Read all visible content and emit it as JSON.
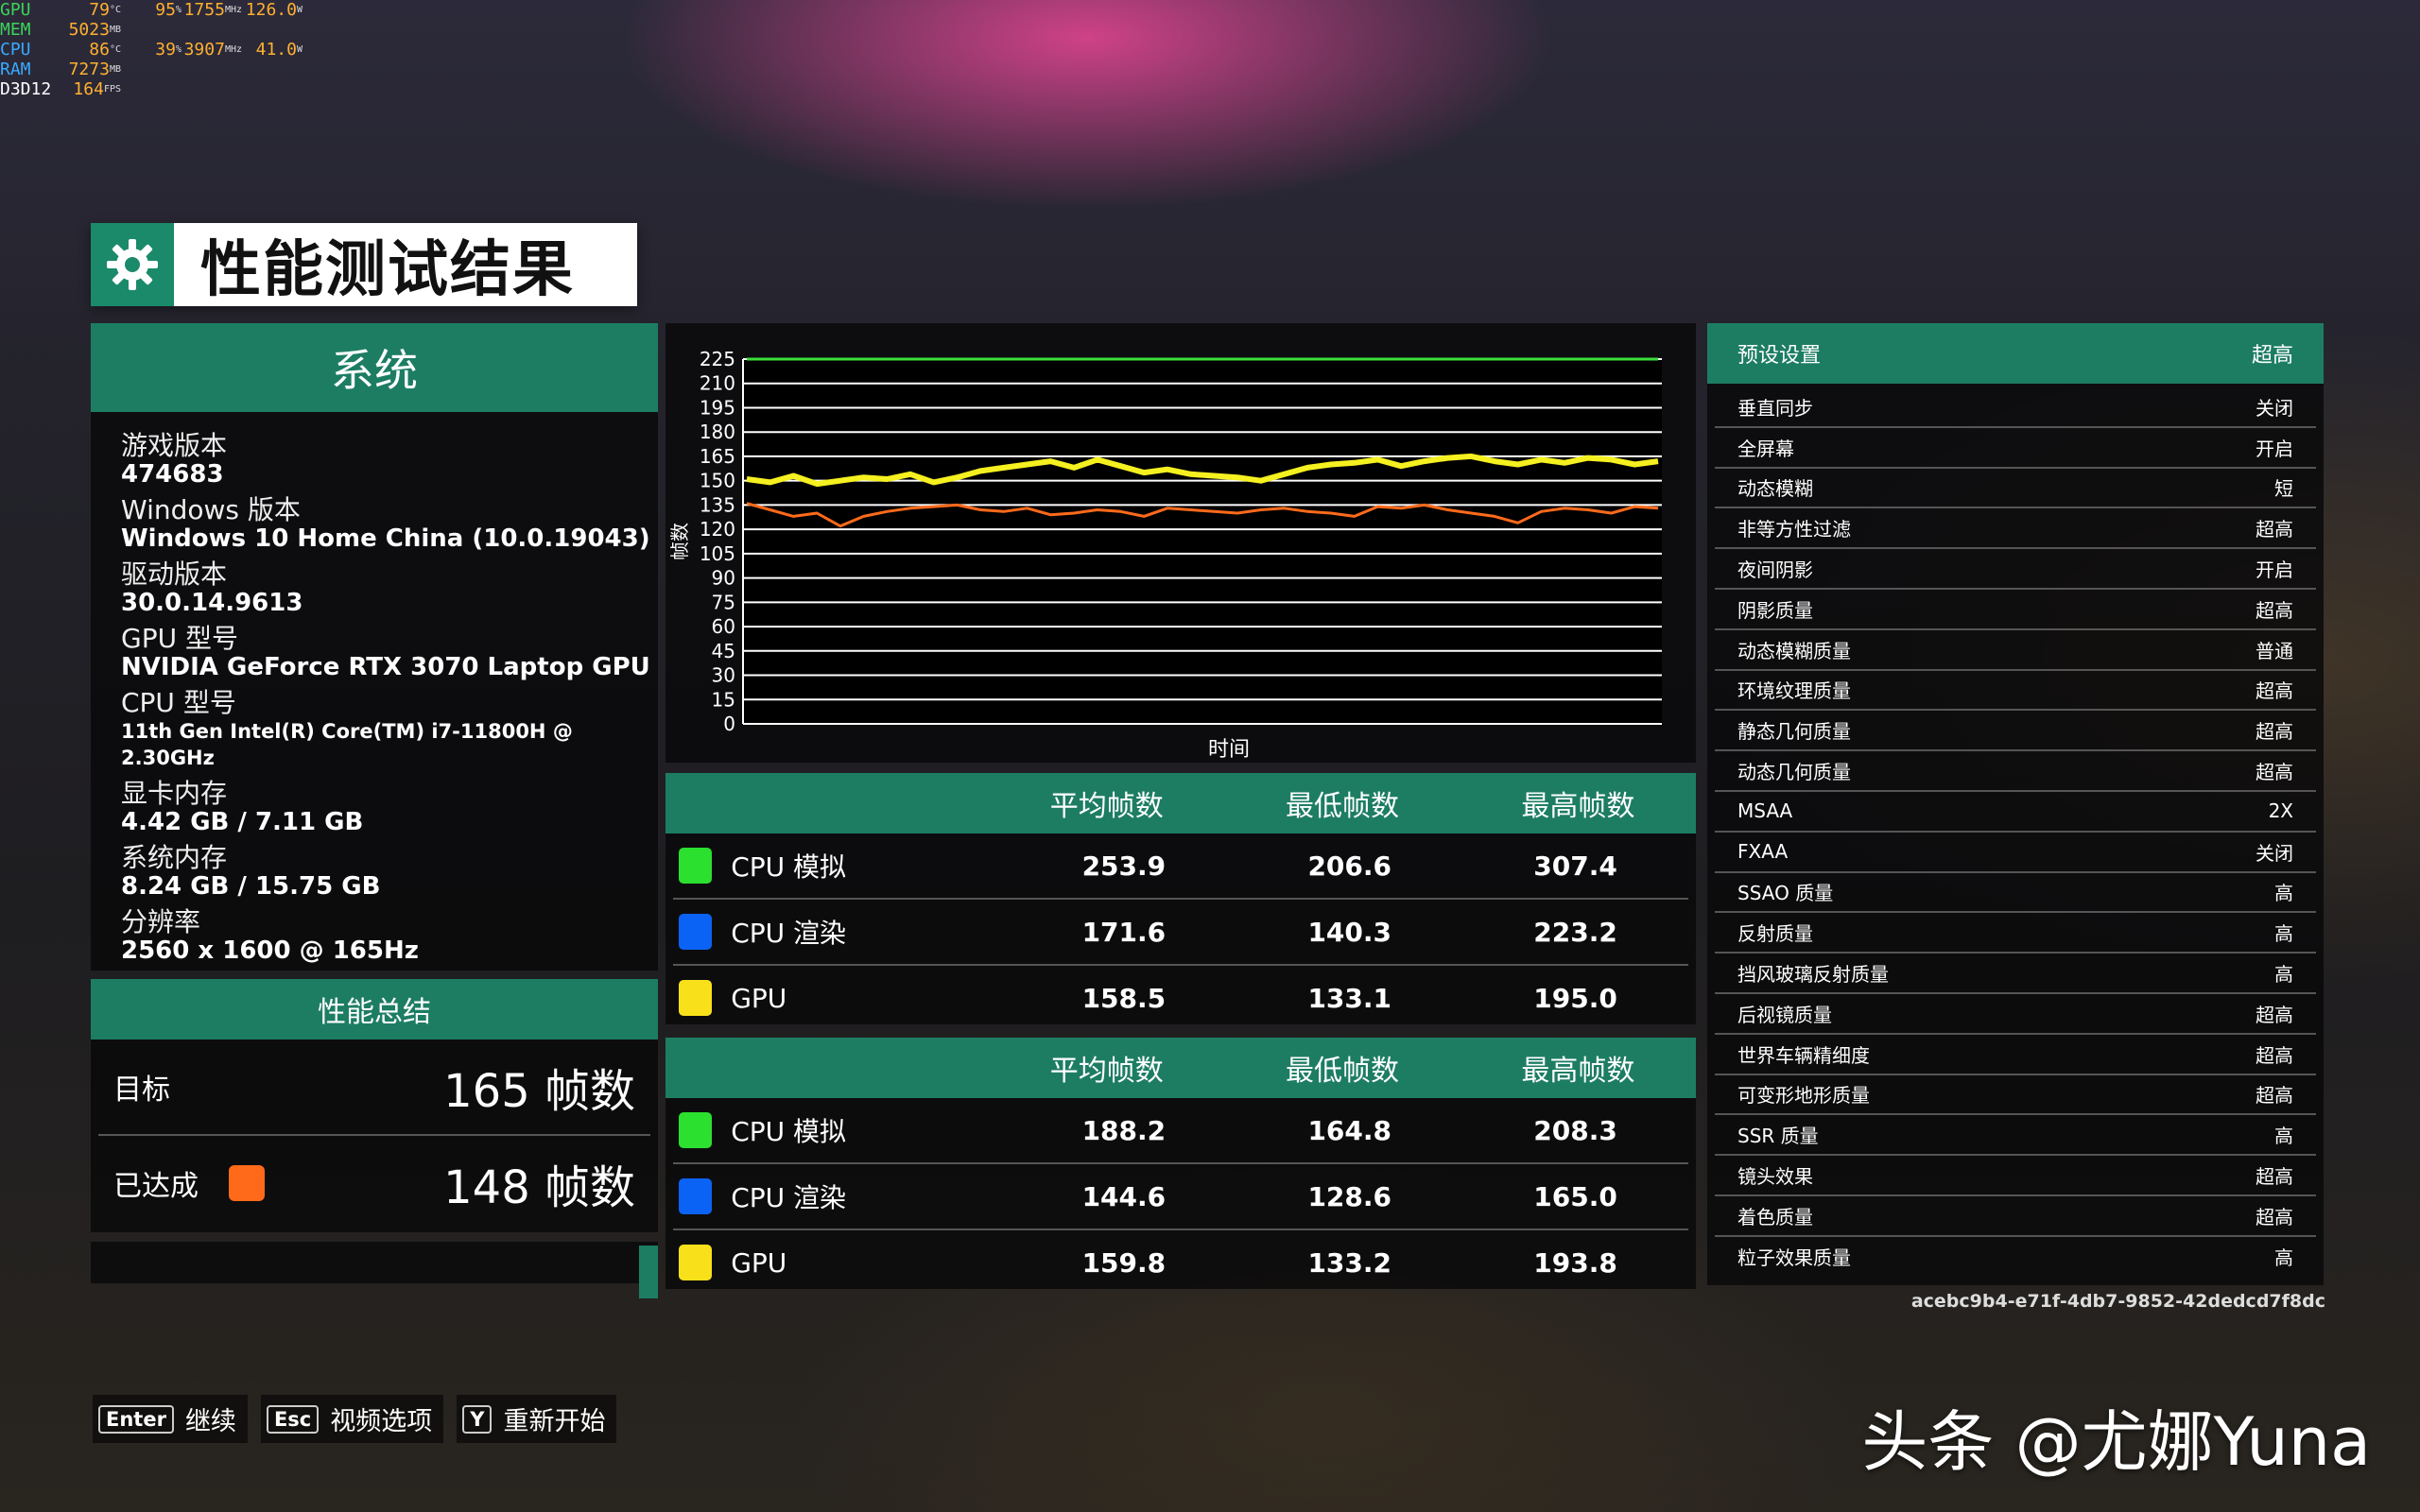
{
  "osd": [
    {
      "label": "GPU",
      "c": "#3cd35a",
      "v1": "79",
      "u1": "°C",
      "v2": "95",
      "u2": "%",
      "v3": "1755",
      "u3": "MHz",
      "v4": "126.0",
      "u4": "W"
    },
    {
      "label": "MEM",
      "c": "#3cd35a",
      "v1": "5023",
      "u1": "MB",
      "v2": "",
      "u2": "",
      "v3": "",
      "u3": "",
      "v4": "",
      "u4": ""
    },
    {
      "label": "CPU",
      "c": "#3aa9ff",
      "v1": "86",
      "u1": "°C",
      "v2": "39",
      "u2": "%",
      "v3": "3907",
      "u3": "MHz",
      "v4": "41.0",
      "u4": "W"
    },
    {
      "label": "RAM",
      "c": "#3aa9ff",
      "v1": "7273",
      "u1": "MB",
      "v2": "",
      "u2": "",
      "v3": "",
      "u3": "",
      "v4": "",
      "u4": ""
    },
    {
      "label": "D3D12",
      "c": "#ffffff",
      "v1": "164",
      "u1": "FPS",
      "v2": "",
      "u2": "",
      "v3": "",
      "u3": "",
      "v4": "",
      "u4": ""
    }
  ],
  "title": "性能测试结果",
  "system": {
    "header": "系统",
    "fields": [
      {
        "label": "游戏版本",
        "value": "474683"
      },
      {
        "label": "Windows 版本",
        "value": "Windows 10 Home China (10.0.19043)"
      },
      {
        "label": "驱动版本",
        "value": "30.0.14.9613"
      },
      {
        "label": "GPU 型号",
        "value": "NVIDIA GeForce RTX 3070 Laptop GPU"
      },
      {
        "label": "CPU 型号",
        "value": "11th Gen Intel(R) Core(TM) i7-11800H @ 2.30GHz"
      },
      {
        "label": "显卡内存",
        "value": "4.42 GB / 7.11 GB"
      },
      {
        "label": "系统内存",
        "value": "8.24 GB / 15.75 GB"
      },
      {
        "label": "分辨率",
        "value": "2560 x 1600 @ 165Hz"
      }
    ]
  },
  "summary": {
    "header": "性能总结",
    "target_label": "目标",
    "target_value": "165 帧数",
    "achieved_label": "已达成",
    "achieved_value": "148 帧数",
    "achieved_color": "#ff6a1a"
  },
  "chart_data": {
    "type": "line",
    "ylabel": "帧数",
    "xlabel": "时间",
    "ylim": [
      0,
      225
    ],
    "yticks": [
      0,
      15,
      30,
      45,
      60,
      75,
      90,
      105,
      120,
      135,
      150,
      165,
      180,
      195,
      210,
      225
    ],
    "grid": true,
    "series": [
      {
        "color": "#39e03a",
        "values": [
          225,
          225,
          225,
          225,
          225,
          225,
          225,
          225,
          225,
          225,
          225,
          225,
          225,
          225,
          225,
          225,
          225,
          225,
          225,
          225,
          225,
          225,
          225,
          225,
          225,
          225,
          225,
          225,
          225,
          225,
          225,
          225,
          225,
          225,
          225,
          225,
          225,
          225,
          225,
          225
        ]
      },
      {
        "color": "#f5f01f",
        "values": [
          151,
          149,
          153,
          148,
          150,
          152,
          151,
          154,
          149,
          152,
          156,
          158,
          160,
          162,
          158,
          163,
          159,
          155,
          157,
          154,
          153,
          152,
          150,
          154,
          158,
          160,
          161,
          163,
          159,
          162,
          164,
          165,
          162,
          160,
          163,
          161,
          164,
          163,
          160,
          162
        ]
      },
      {
        "color": "#ff6a1a",
        "values": [
          136,
          132,
          128,
          130,
          122,
          128,
          131,
          133,
          134,
          135,
          132,
          131,
          133,
          129,
          130,
          132,
          131,
          128,
          133,
          132,
          131,
          130,
          132,
          133,
          131,
          130,
          128,
          134,
          133,
          135,
          132,
          130,
          128,
          124,
          131,
          133,
          132,
          130,
          134,
          133
        ]
      }
    ]
  },
  "tables": [
    {
      "headers": [
        "平均帧数",
        "最低帧数",
        "最高帧数"
      ],
      "rows": [
        {
          "name": "CPU 模拟",
          "color": "#2be02f",
          "avg": "253.9",
          "min": "206.6",
          "max": "307.4"
        },
        {
          "name": "CPU 渲染",
          "color": "#0b63f5",
          "avg": "171.6",
          "min": "140.3",
          "max": "223.2"
        },
        {
          "name": "GPU",
          "color": "#f8e11a",
          "avg": "158.5",
          "min": "133.1",
          "max": "195.0"
        }
      ]
    },
    {
      "headers": [
        "平均帧数",
        "最低帧数",
        "最高帧数"
      ],
      "rows": [
        {
          "name": "CPU 模拟",
          "color": "#2be02f",
          "avg": "188.2",
          "min": "164.8",
          "max": "208.3"
        },
        {
          "name": "CPU 渲染",
          "color": "#0b63f5",
          "avg": "144.6",
          "min": "128.6",
          "max": "165.0"
        },
        {
          "name": "GPU",
          "color": "#f8e11a",
          "avg": "159.8",
          "min": "133.2",
          "max": "193.8"
        }
      ]
    }
  ],
  "settings": {
    "preset_label": "预设设置",
    "preset_value": "超高",
    "items": [
      {
        "label": "垂直同步",
        "value": "关闭"
      },
      {
        "label": "全屏幕",
        "value": "开启"
      },
      {
        "label": "动态模糊",
        "value": "短"
      },
      {
        "label": "非等方性过滤",
        "value": "超高"
      },
      {
        "label": "夜间阴影",
        "value": "开启"
      },
      {
        "label": "阴影质量",
        "value": "超高"
      },
      {
        "label": "动态模糊质量",
        "value": "普通"
      },
      {
        "label": "环境纹理质量",
        "value": "超高"
      },
      {
        "label": "静态几何质量",
        "value": "超高"
      },
      {
        "label": "动态几何质量",
        "value": "超高"
      },
      {
        "label": "MSAA",
        "value": "2X"
      },
      {
        "label": "FXAA",
        "value": "关闭"
      },
      {
        "label": "SSAO 质量",
        "value": "高"
      },
      {
        "label": "反射质量",
        "value": "高"
      },
      {
        "label": "挡风玻璃反射质量",
        "value": "高"
      },
      {
        "label": "后视镜质量",
        "value": "超高"
      },
      {
        "label": "世界车辆精细度",
        "value": "超高"
      },
      {
        "label": "可变形地形质量",
        "value": "超高"
      },
      {
        "label": "SSR 质量",
        "value": "高"
      },
      {
        "label": "镜头效果",
        "value": "超高"
      },
      {
        "label": "着色质量",
        "value": "超高"
      },
      {
        "label": "粒子效果质量",
        "value": "高"
      }
    ]
  },
  "uuid": "acebc9b4-e71f-4db7-9852-42dedcd7f8dc",
  "prompts": [
    {
      "key": "Enter",
      "label": "继续"
    },
    {
      "key": "Esc",
      "label": "视频选项"
    },
    {
      "key": "Y",
      "label": "重新开始"
    }
  ],
  "watermark": "头条 @尤娜Yuna"
}
